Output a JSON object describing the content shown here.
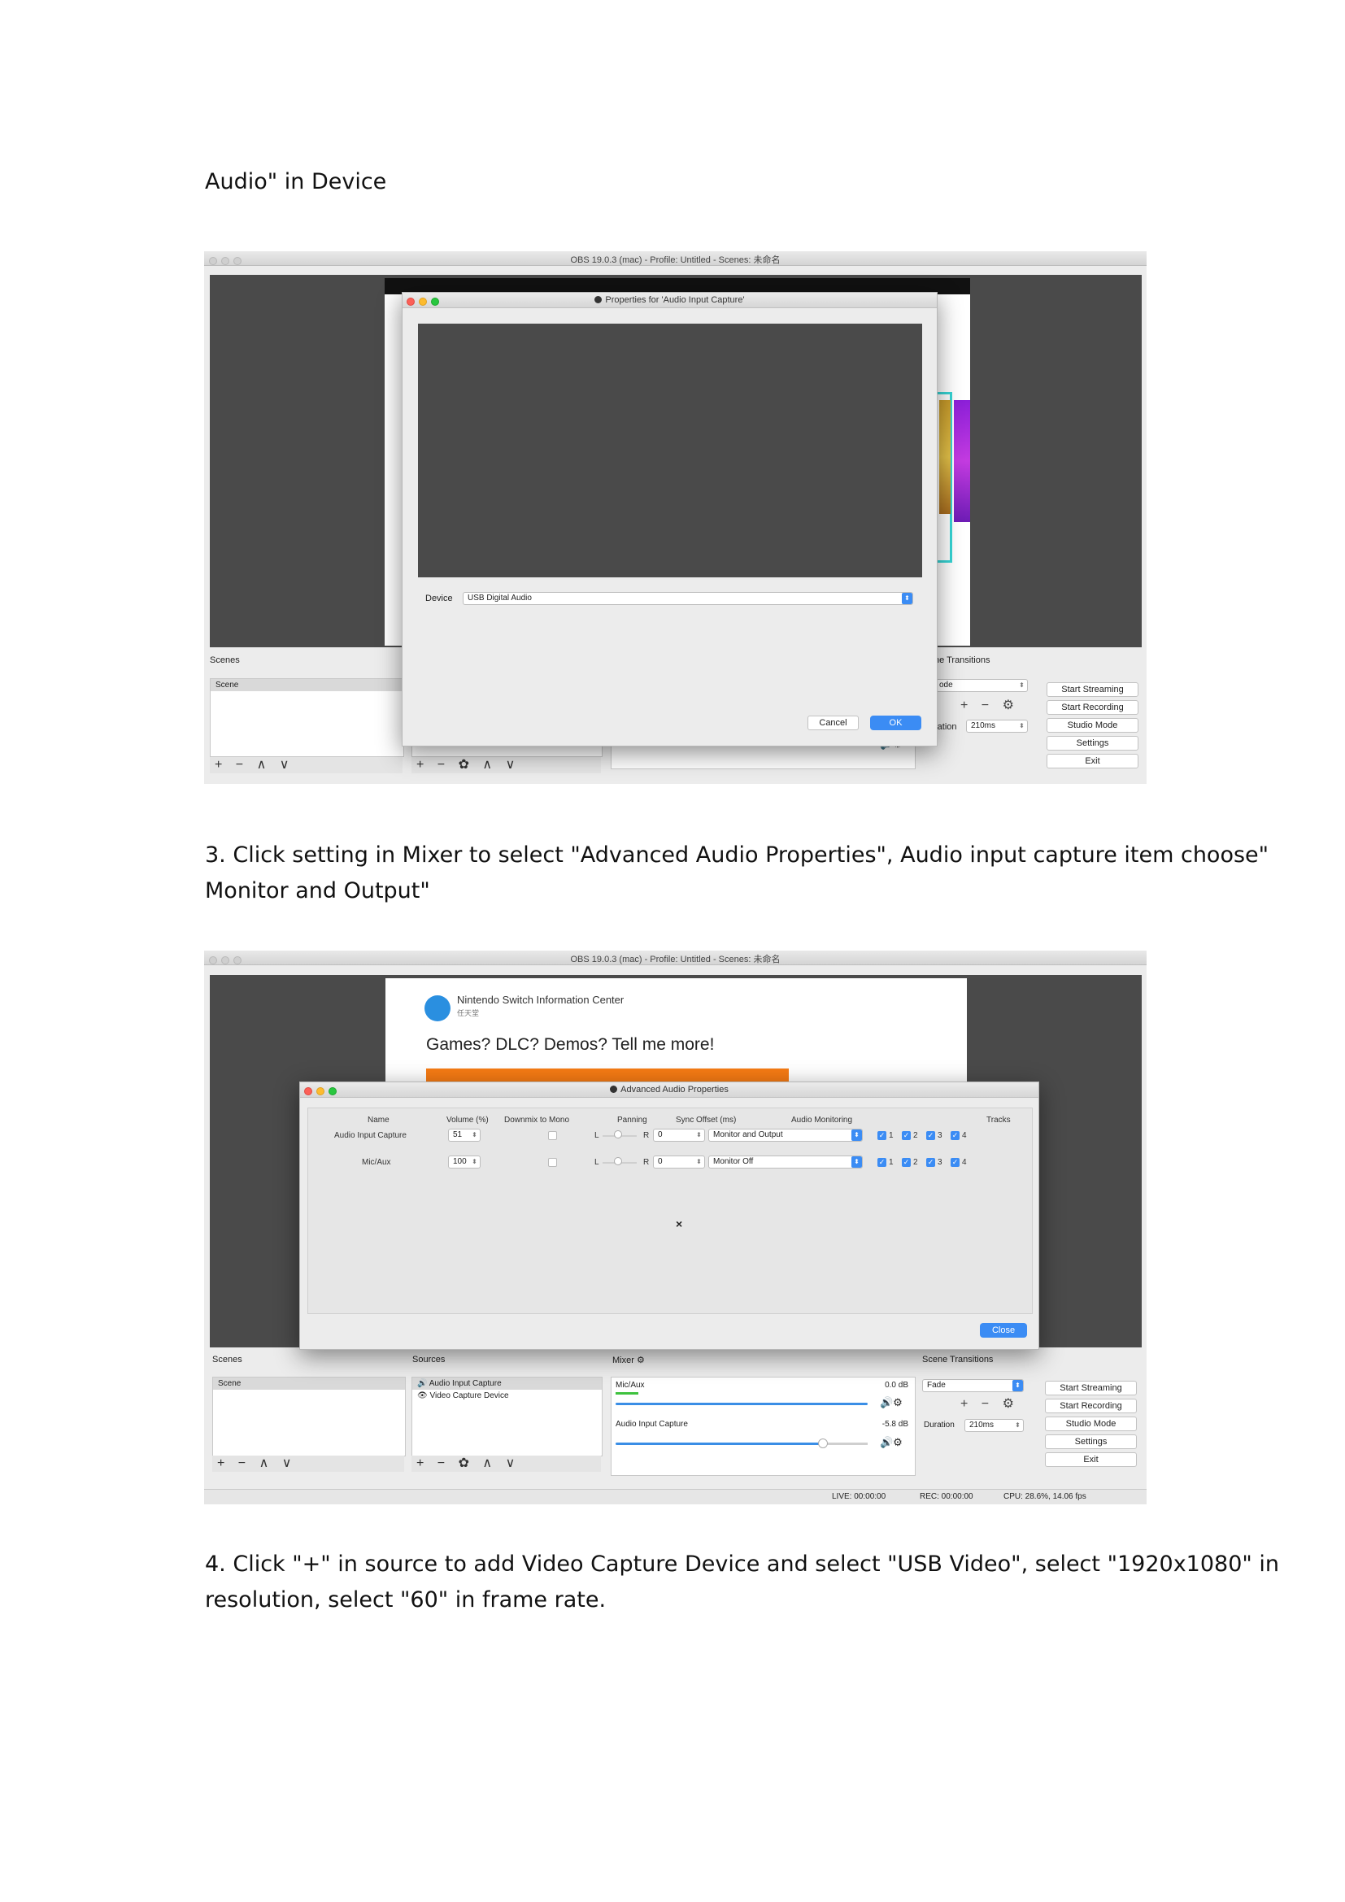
{
  "doc": {
    "line_top": "Audio\" in Device",
    "step3_line1": "3. Click setting in Mixer to select \"Advanced Audio Properties\", Audio input capture item choose\"",
    "step3_line2": "Monitor and Output\"",
    "step4_line1": "4. Click \"+\" in source to add Video Capture Device and select \"USB Video\", select \"1920x1080\" in",
    "step4_line2": "resolution, select \"60\" in frame rate."
  },
  "shot1": {
    "window_title": "OBS 19.0.3 (mac) - Profile: Untitled - Scenes: 未命名",
    "scenes_label": "Scenes",
    "scene_item": "Scene",
    "transitions_label": "ne Transitions",
    "mode_label": "ode",
    "duration_label": "ration",
    "duration_value": "210ms",
    "buttons": {
      "start_streaming": "Start Streaming",
      "start_recording": "Start Recording",
      "studio_mode": "Studio Mode",
      "settings": "Settings",
      "exit": "Exit"
    },
    "dialog": {
      "title": "Properties for 'Audio Input Capture'",
      "device_label": "Device",
      "device_value": "USB Digital Audio",
      "cancel": "Cancel",
      "ok": "OK"
    }
  },
  "shot2": {
    "window_title": "OBS 19.0.3 (mac) - Profile: Untitled - Scenes: 未命名",
    "browser": {
      "site_name": "Nintendo Switch Information Center",
      "site_sub": "任天堂",
      "headline": "Games? DLC? Demos? Tell me more!"
    },
    "dialog": {
      "title": "Advanced Audio Properties",
      "headers": {
        "name": "Name",
        "volume": "Volume (%)",
        "downmix": "Downmix to Mono",
        "panning": "Panning",
        "sync": "Sync Offset (ms)",
        "monitoring": "Audio Monitoring",
        "tracks": "Tracks"
      },
      "rows": [
        {
          "name": "Audio Input Capture",
          "volume": "51",
          "pan_l": "L",
          "pan_r": "R",
          "sync": "0",
          "monitoring": "Monitor and Output"
        },
        {
          "name": "Mic/Aux",
          "volume": "100",
          "pan_l": "L",
          "pan_r": "R",
          "sync": "0",
          "monitoring": "Monitor Off"
        }
      ],
      "track_labels": [
        "1",
        "2",
        "3",
        "4"
      ],
      "close": "Close"
    },
    "labels": {
      "scenes": "Scenes",
      "sources": "Sources",
      "mixer": "Mixer",
      "scene_transitions": "Scene Transitions"
    },
    "scene_item": "Scene",
    "sources": [
      "Audio Input Capture",
      "Video Capture Device"
    ],
    "mixer": [
      {
        "name": "Mic/Aux",
        "db": "0.0 dB",
        "level": 0.97
      },
      {
        "name": "Audio Input Capture",
        "db": "-5.8 dB",
        "level": 0.79
      }
    ],
    "transition_value": "Fade",
    "duration_label": "Duration",
    "duration_value": "210ms",
    "buttons": {
      "start_streaming": "Start Streaming",
      "start_recording": "Start Recording",
      "studio_mode": "Studio Mode",
      "settings": "Settings",
      "exit": "Exit"
    },
    "status": {
      "live": "LIVE: 00:00:00",
      "rec": "REC: 00:00:00",
      "cpu": "CPU: 28.6%, 14.06 fps"
    }
  }
}
